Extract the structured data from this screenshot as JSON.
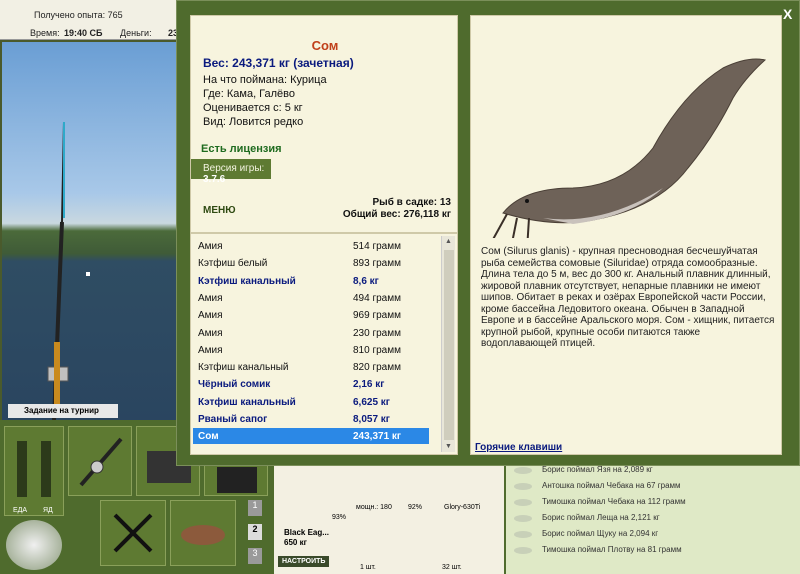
{
  "topbar": {
    "exp_label": "Получено опыта: 765",
    "time_label": "Время:",
    "time_value": "19:40 СБ",
    "money_label": "Деньги:",
    "money_value": "23"
  },
  "scene": {
    "task_label": "Задание на турнир"
  },
  "bottom": {
    "left_labels": [
      "ЕДА",
      "ЯД"
    ],
    "page_numbers": [
      "1",
      "2",
      "3"
    ],
    "rod_name": "Black Eag...",
    "rod_weight": "650 кг",
    "rod_percent": "93%",
    "tune_button": "НАСТРОИТЬ",
    "reel_power": "мощн.: 180",
    "reel_percent": "92%",
    "line_name": "Glory-630Ti",
    "hook_count": "1 шт.",
    "bait_count": "32 шт."
  },
  "feed": [
    "Борис поймал Язя на 2,089 кг",
    "Антошка поймал Чебака на 67 грамм",
    "Тимошка поймал Чебака на 112 грамм",
    "Борис поймал Леща на 2,121 кг",
    "Борис поймал Щуку на 2,094 кг",
    "Тимошка поймал Плотву на 81 грамм"
  ],
  "panel": {
    "close": "X",
    "fish_name": "Сом",
    "weight": "Вес: 243,371 кг (зачетная)",
    "caught_on": "На что поймана: Курица",
    "where": "Где: Кама, Галёво",
    "valued_from": "Оценивается с: 5 кг",
    "view": "Вид: Ловится редко",
    "license": "Есть лицензия",
    "version_label": "Версия игры:",
    "version_value": "3.7.6",
    "menu": "МЕНЮ",
    "cage_count": "Рыб в садке: 13",
    "total_weight": "Общий вес: 276,118 кг",
    "catch_list": [
      {
        "name": "Амия",
        "weight": "514 грамм",
        "bold": false
      },
      {
        "name": "Кэтфиш белый",
        "weight": "893 грамм",
        "bold": false
      },
      {
        "name": "Кэтфиш канальный",
        "weight": "8,6 кг",
        "bold": true
      },
      {
        "name": "Амия",
        "weight": "494 грамм",
        "bold": false
      },
      {
        "name": "Амия",
        "weight": "969 грамм",
        "bold": false
      },
      {
        "name": "Амия",
        "weight": "230 грамм",
        "bold": false
      },
      {
        "name": "Амия",
        "weight": "810 грамм",
        "bold": false
      },
      {
        "name": "Кэтфиш канальный",
        "weight": "820 грамм",
        "bold": false
      },
      {
        "name": "Чёрный сомик",
        "weight": "2,16 кг",
        "bold": true
      },
      {
        "name": "Кэтфиш канальный",
        "weight": "6,625 кг",
        "bold": true
      },
      {
        "name": "Рваный сапог",
        "weight": "8,057 кг",
        "bold": true
      },
      {
        "name": "Сом",
        "weight": "243,371 кг",
        "bold": true,
        "selected": true
      }
    ],
    "description": "Сом (Silurus glanis) - крупная пресноводная бесчешуйчатая рыба семейства сомовые (Siluridae) отряда сомообразные. Длина тела до 5 м, вес до 300 кг. Анальный плавник длинный, жировой плавник отсутствует, непарные плавники не имеют шипов. Обитает в реках и озёрах Европейской части России, кроме бассейна Ледовитого океана. Обычен в Западной Европе и в бассейне Аральского моря. Сом - хищник, питается крупной рыбой, крупные особи питаются также водоплавающей птицей.",
    "hotkeys": "Горячие клавиши"
  }
}
